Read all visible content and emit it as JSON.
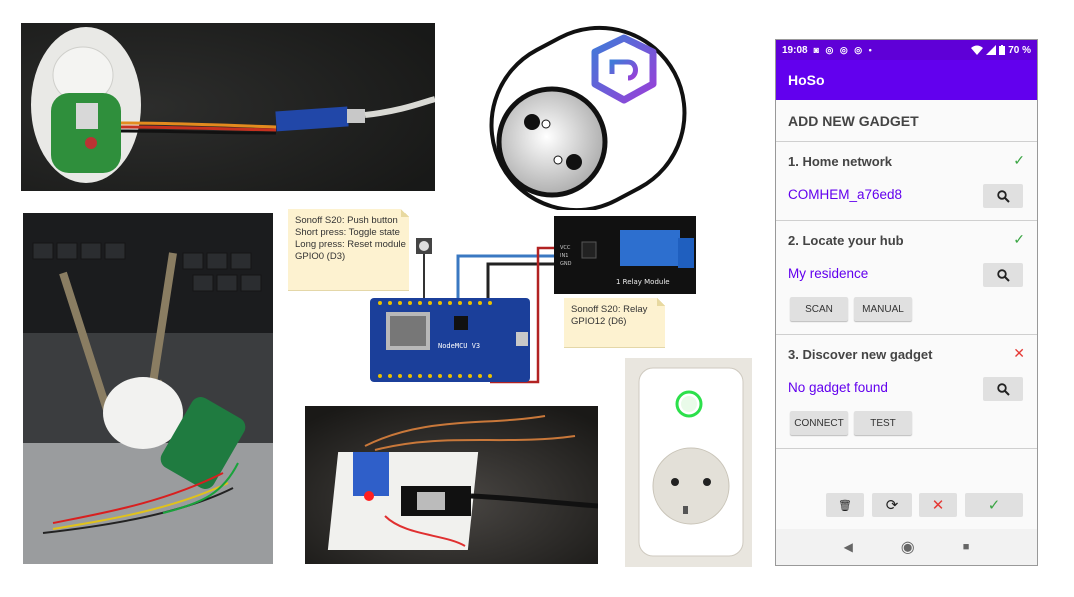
{
  "notes": {
    "push_button": {
      "title": "Sonoff S20: Push button",
      "short_press": "Short press: Toggle state",
      "long_press": "Long press:  Reset module",
      "gpio": "GPIO0 (D3)"
    },
    "relay": {
      "title": "Sonoff S20: Relay",
      "gpio": "GPIO12 (D6)"
    }
  },
  "board": {
    "nodemcu_label": "NodeMCU V3",
    "relay_label": "1 Relay Module",
    "pins": [
      "VCC",
      "IN1",
      "GND"
    ]
  },
  "phone": {
    "status": {
      "time": "19:08",
      "icons": "◙ ◎ ◎ ◎ •",
      "battery": "70 %"
    },
    "app_title": "HoSo",
    "heading": "ADD NEW GADGET",
    "sections": [
      {
        "title": "1. Home network",
        "status": "✓",
        "value": "COMHEM_a76ed8"
      },
      {
        "title": "2. Locate your hub",
        "status": "✓",
        "value": "My residence",
        "buttons": [
          "SCAN",
          "MANUAL"
        ]
      },
      {
        "title": "3. Discover new gadget",
        "status": "✕",
        "value": "No gadget found",
        "buttons": [
          "CONNECT",
          "TEST"
        ]
      }
    ],
    "toolbar": {
      "delete": "🗑",
      "refresh": "⟳",
      "cancel": "✕",
      "confirm": "✓"
    },
    "nav": {
      "back": "◀",
      "home": "◉",
      "recents": "■"
    }
  }
}
